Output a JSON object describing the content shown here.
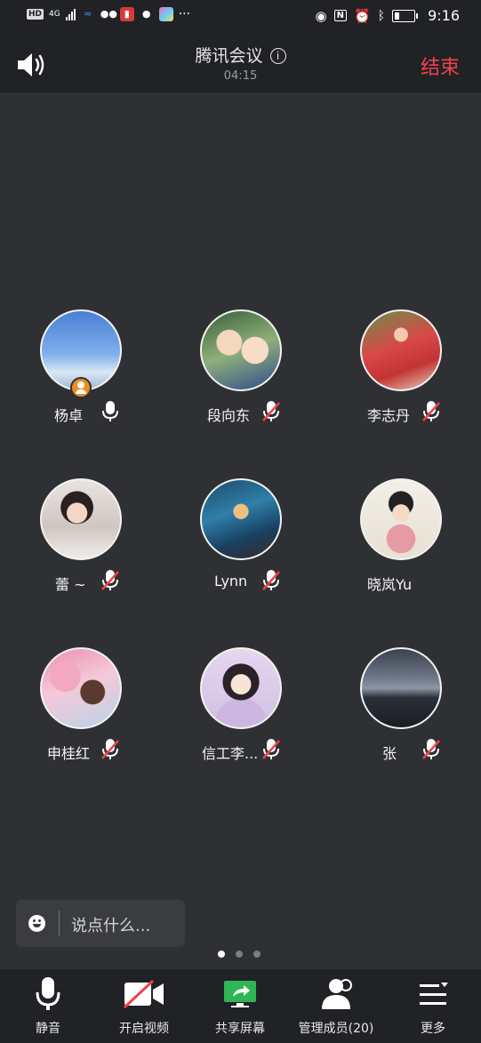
{
  "status_bar": {
    "hd": "HD",
    "network": "4G",
    "time": "9:16",
    "left_icons": [
      "hd-icon",
      "signal-icon",
      "app-icon",
      "wechat-icon",
      "recorder-icon",
      "message-icon",
      "gallery-icon",
      "more-dots-icon"
    ],
    "right_icons": [
      "eye-icon",
      "nfc-icon",
      "alarm-icon",
      "bluetooth-icon",
      "battery-icon"
    ],
    "more": "···"
  },
  "header": {
    "title": "腾讯会议",
    "timer": "04:15",
    "end_label": "结束",
    "end_color": "#f0414b"
  },
  "participants": [
    {
      "name": "杨卓",
      "mic": "on",
      "host": true
    },
    {
      "name": "段向东",
      "mic": "muted"
    },
    {
      "name": "李志丹",
      "mic": "muted"
    },
    {
      "name": "蕾 ~",
      "mic": "muted"
    },
    {
      "name": "Lynn",
      "mic": "muted"
    },
    {
      "name": "晓岚Yu",
      "mic": "none"
    },
    {
      "name": "申桂红",
      "mic": "muted"
    },
    {
      "name": "信工李...",
      "mic": "muted"
    },
    {
      "name": "张",
      "mic": "muted"
    }
  ],
  "chat": {
    "placeholder": "说点什么..."
  },
  "pager": {
    "total": 3,
    "current": 1
  },
  "toolbar": {
    "mute": "静音",
    "video": "开启视频",
    "share": "共享屏幕",
    "members": "管理成员(20)",
    "more": "更多"
  },
  "colors": {
    "background": "#2e3033",
    "bar": "#202225",
    "accent_red": "#f0414b",
    "share_green": "#2fb553",
    "host_badge": "#f08a24"
  }
}
